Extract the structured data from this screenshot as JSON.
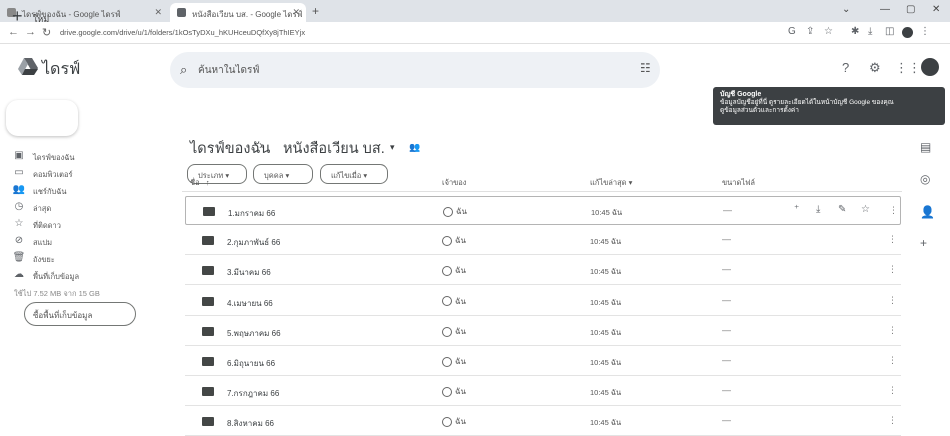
{
  "browser": {
    "tab1_title": "ไดรฟ์ของฉัน - Google ไดรฟ์",
    "tab2_title": "หนังสือเวียน บส. - Google ไดรฟ์",
    "url": "drive.google.com/drive/u/1/folders/1kOsTyDXu_hKUHceuDQfXy8jThIEYjx"
  },
  "app": {
    "title": "ไดรฟ์"
  },
  "search": {
    "placeholder": "ค้นหาในไดรฟ์"
  },
  "tooltip": {
    "title": "บัญชี Google",
    "line1": "ข้อมูลบัญชีอยู่ที่นี่ ดูรายละเอียดได้ในหน้าบัญชี Google ของคุณ",
    "line2": "ดูข้อมูลส่วนตัวและการตั้งค่า"
  },
  "new_button": {
    "label": "ใหม่"
  },
  "sidebar": {
    "items": [
      {
        "label": "ไดรฟ์ของฉัน",
        "icon": "my-drive-icon"
      },
      {
        "label": "คอมพิวเตอร์",
        "icon": "computer-icon"
      },
      {
        "label": "แชร์กับฉัน",
        "icon": "shared-icon"
      },
      {
        "label": "ล่าสุด",
        "icon": "clock-icon"
      },
      {
        "label": "ที่ติดดาว",
        "icon": "star-icon"
      },
      {
        "label": "สแปม",
        "icon": "spam-icon"
      },
      {
        "label": "ถังขยะ",
        "icon": "trash-icon"
      },
      {
        "label": "พื้นที่เก็บข้อมูล",
        "icon": "cloud-icon"
      }
    ],
    "storage_text": "ใช้ไป 7.52 MB จาก 15 GB",
    "buy_storage": "ซื้อพื้นที่เก็บข้อมูล"
  },
  "breadcrumb": {
    "root": "ไดรฟ์ของฉัน",
    "current": "หนังสือเวียน บส."
  },
  "filters": [
    "ประเภท",
    "บุคคล",
    "แก้ไขเมื่อ"
  ],
  "columns": {
    "name": "ชื่อ",
    "owner": "เจ้าของ",
    "modified": "แก้ไขล่าสุด",
    "size": "ขนาดไฟล์"
  },
  "rows": [
    {
      "name": "1.มกราคม 66",
      "owner": "ฉัน",
      "modified": "10:45 ฉัน",
      "size": "—"
    },
    {
      "name": "2.กุมภาพันธ์ 66",
      "owner": "ฉัน",
      "modified": "10:45 ฉัน",
      "size": "—"
    },
    {
      "name": "3.มีนาคม 66",
      "owner": "ฉัน",
      "modified": "10:45 ฉัน",
      "size": "—"
    },
    {
      "name": "4.เมษายน 66",
      "owner": "ฉัน",
      "modified": "10:45 ฉัน",
      "size": "—"
    },
    {
      "name": "5.พฤษภาคม 66",
      "owner": "ฉัน",
      "modified": "10:45 ฉัน",
      "size": "—"
    },
    {
      "name": "6.มิถุนายน 66",
      "owner": "ฉัน",
      "modified": "10:45 ฉัน",
      "size": "—"
    },
    {
      "name": "7.กรกฎาคม 66",
      "owner": "ฉัน",
      "modified": "10:45 ฉัน",
      "size": "—"
    },
    {
      "name": "8.สิงหาคม 66",
      "owner": "ฉัน",
      "modified": "10:45 ฉัน",
      "size": "—"
    }
  ],
  "colors": {
    "accent": "#1a73e8",
    "drive_green": "#188038",
    "drive_yellow": "#fbbc04",
    "drive_blue": "#4285f4"
  }
}
